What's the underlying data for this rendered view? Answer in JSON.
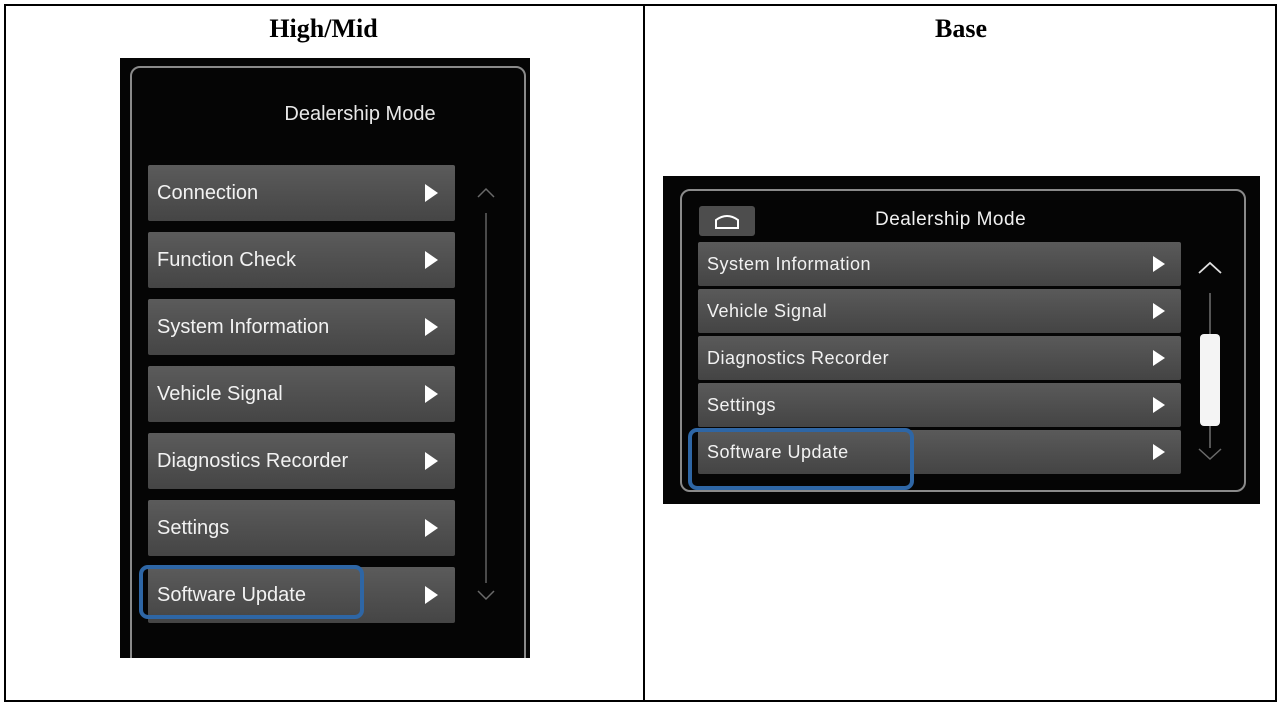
{
  "headers": {
    "high_mid": "High/Mid",
    "base": "Base"
  },
  "high_mid": {
    "title": "Dealership Mode",
    "items": [
      {
        "label": "Connection"
      },
      {
        "label": "Function Check"
      },
      {
        "label": "System Information"
      },
      {
        "label": "Vehicle Signal"
      },
      {
        "label": "Diagnostics Recorder"
      },
      {
        "label": "Settings"
      },
      {
        "label": "Software Update"
      }
    ],
    "highlighted_item": "Software Update"
  },
  "base": {
    "title": "Dealership Mode",
    "home_icon": "home-icon",
    "items": [
      {
        "label": "System Information"
      },
      {
        "label": "Vehicle Signal"
      },
      {
        "label": "Diagnostics Recorder"
      },
      {
        "label": "Settings"
      },
      {
        "label": "Software Update"
      }
    ],
    "highlighted_item": "Software Update"
  },
  "colors": {
    "highlight": "#2e66a5",
    "screen_bg": "#050505",
    "item_bg": "#545454"
  }
}
